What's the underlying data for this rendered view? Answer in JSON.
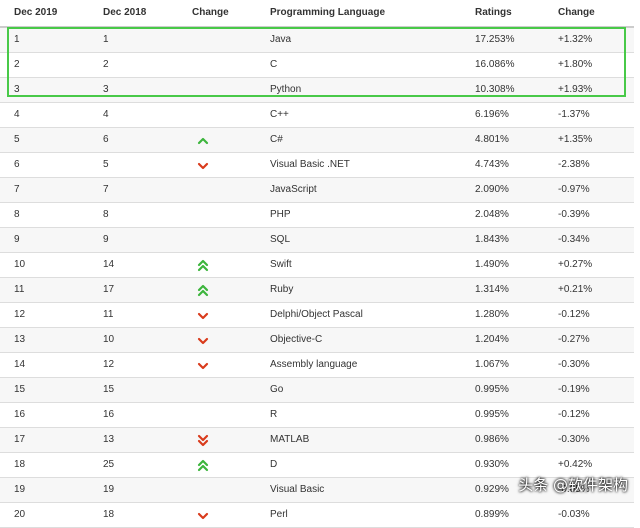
{
  "headers": {
    "dec2019": "Dec 2019",
    "dec2018": "Dec 2018",
    "change": "Change",
    "language": "Programming Language",
    "ratings": "Ratings",
    "change2": "Change"
  },
  "colors": {
    "up": "#3db53d",
    "down": "#d93b1c",
    "highlight": "#48c948"
  },
  "rows": [
    {
      "r2019": "1",
      "r2018": "1",
      "trend": "none",
      "lang": "Java",
      "rating": "17.253%",
      "change": "+1.32%"
    },
    {
      "r2019": "2",
      "r2018": "2",
      "trend": "none",
      "lang": "C",
      "rating": "16.086%",
      "change": "+1.80%"
    },
    {
      "r2019": "3",
      "r2018": "3",
      "trend": "none",
      "lang": "Python",
      "rating": "10.308%",
      "change": "+1.93%"
    },
    {
      "r2019": "4",
      "r2018": "4",
      "trend": "none",
      "lang": "C++",
      "rating": "6.196%",
      "change": "-1.37%"
    },
    {
      "r2019": "5",
      "r2018": "6",
      "trend": "up",
      "lang": "C#",
      "rating": "4.801%",
      "change": "+1.35%"
    },
    {
      "r2019": "6",
      "r2018": "5",
      "trend": "down",
      "lang": "Visual Basic .NET",
      "rating": "4.743%",
      "change": "-2.38%"
    },
    {
      "r2019": "7",
      "r2018": "7",
      "trend": "none",
      "lang": "JavaScript",
      "rating": "2.090%",
      "change": "-0.97%"
    },
    {
      "r2019": "8",
      "r2018": "8",
      "trend": "none",
      "lang": "PHP",
      "rating": "2.048%",
      "change": "-0.39%"
    },
    {
      "r2019": "9",
      "r2018": "9",
      "trend": "none",
      "lang": "SQL",
      "rating": "1.843%",
      "change": "-0.34%"
    },
    {
      "r2019": "10",
      "r2018": "14",
      "trend": "up2",
      "lang": "Swift",
      "rating": "1.490%",
      "change": "+0.27%"
    },
    {
      "r2019": "11",
      "r2018": "17",
      "trend": "up2",
      "lang": "Ruby",
      "rating": "1.314%",
      "change": "+0.21%"
    },
    {
      "r2019": "12",
      "r2018": "11",
      "trend": "down",
      "lang": "Delphi/Object Pascal",
      "rating": "1.280%",
      "change": "-0.12%"
    },
    {
      "r2019": "13",
      "r2018": "10",
      "trend": "down",
      "lang": "Objective-C",
      "rating": "1.204%",
      "change": "-0.27%"
    },
    {
      "r2019": "14",
      "r2018": "12",
      "trend": "down",
      "lang": "Assembly language",
      "rating": "1.067%",
      "change": "-0.30%"
    },
    {
      "r2019": "15",
      "r2018": "15",
      "trend": "none",
      "lang": "Go",
      "rating": "0.995%",
      "change": "-0.19%"
    },
    {
      "r2019": "16",
      "r2018": "16",
      "trend": "none",
      "lang": "R",
      "rating": "0.995%",
      "change": "-0.12%"
    },
    {
      "r2019": "17",
      "r2018": "13",
      "trend": "down2",
      "lang": "MATLAB",
      "rating": "0.986%",
      "change": "-0.30%"
    },
    {
      "r2019": "18",
      "r2018": "25",
      "trend": "up2",
      "lang": "D",
      "rating": "0.930%",
      "change": "+0.42%"
    },
    {
      "r2019": "19",
      "r2018": "19",
      "trend": "none",
      "lang": "Visual Basic",
      "rating": "0.929%",
      "change": "-0.05%"
    },
    {
      "r2019": "20",
      "r2018": "18",
      "trend": "down",
      "lang": "Perl",
      "rating": "0.899%",
      "change": "-0.03%"
    }
  ],
  "watermark": "头条 @软件架构"
}
